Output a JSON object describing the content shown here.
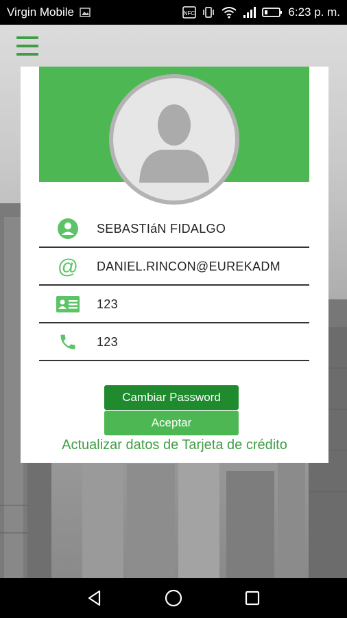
{
  "status_bar": {
    "carrier": "Virgin Mobile",
    "time": "6:23 p. m.",
    "icons": [
      "image-icon",
      "nfc-icon",
      "vibrate-icon",
      "wifi-icon",
      "signal-icon",
      "battery-icon"
    ]
  },
  "menu": {
    "icon": "hamburger-menu-icon"
  },
  "profile": {
    "avatar_icon": "user-silhouette-icon",
    "fields": [
      {
        "icon": "user-circle-icon",
        "value": "SEBASTIáN FIDALGO"
      },
      {
        "icon": "at-sign-icon",
        "value": "DANIEL.RINCON@EUREKADM"
      },
      {
        "icon": "id-card-icon",
        "value": "123"
      },
      {
        "icon": "phone-icon",
        "value": "123"
      }
    ]
  },
  "buttons": {
    "change_password": "Cambiar Password",
    "accept": "Aceptar"
  },
  "link": {
    "update_card": "Actualizar datos de Tarjeta de crédito"
  },
  "colors": {
    "accent": "#4db853",
    "accent_dark": "#1f8a2e",
    "link": "#3f9e44"
  },
  "nav_bar": {
    "icons": [
      "back-icon",
      "home-icon",
      "recents-icon"
    ]
  }
}
